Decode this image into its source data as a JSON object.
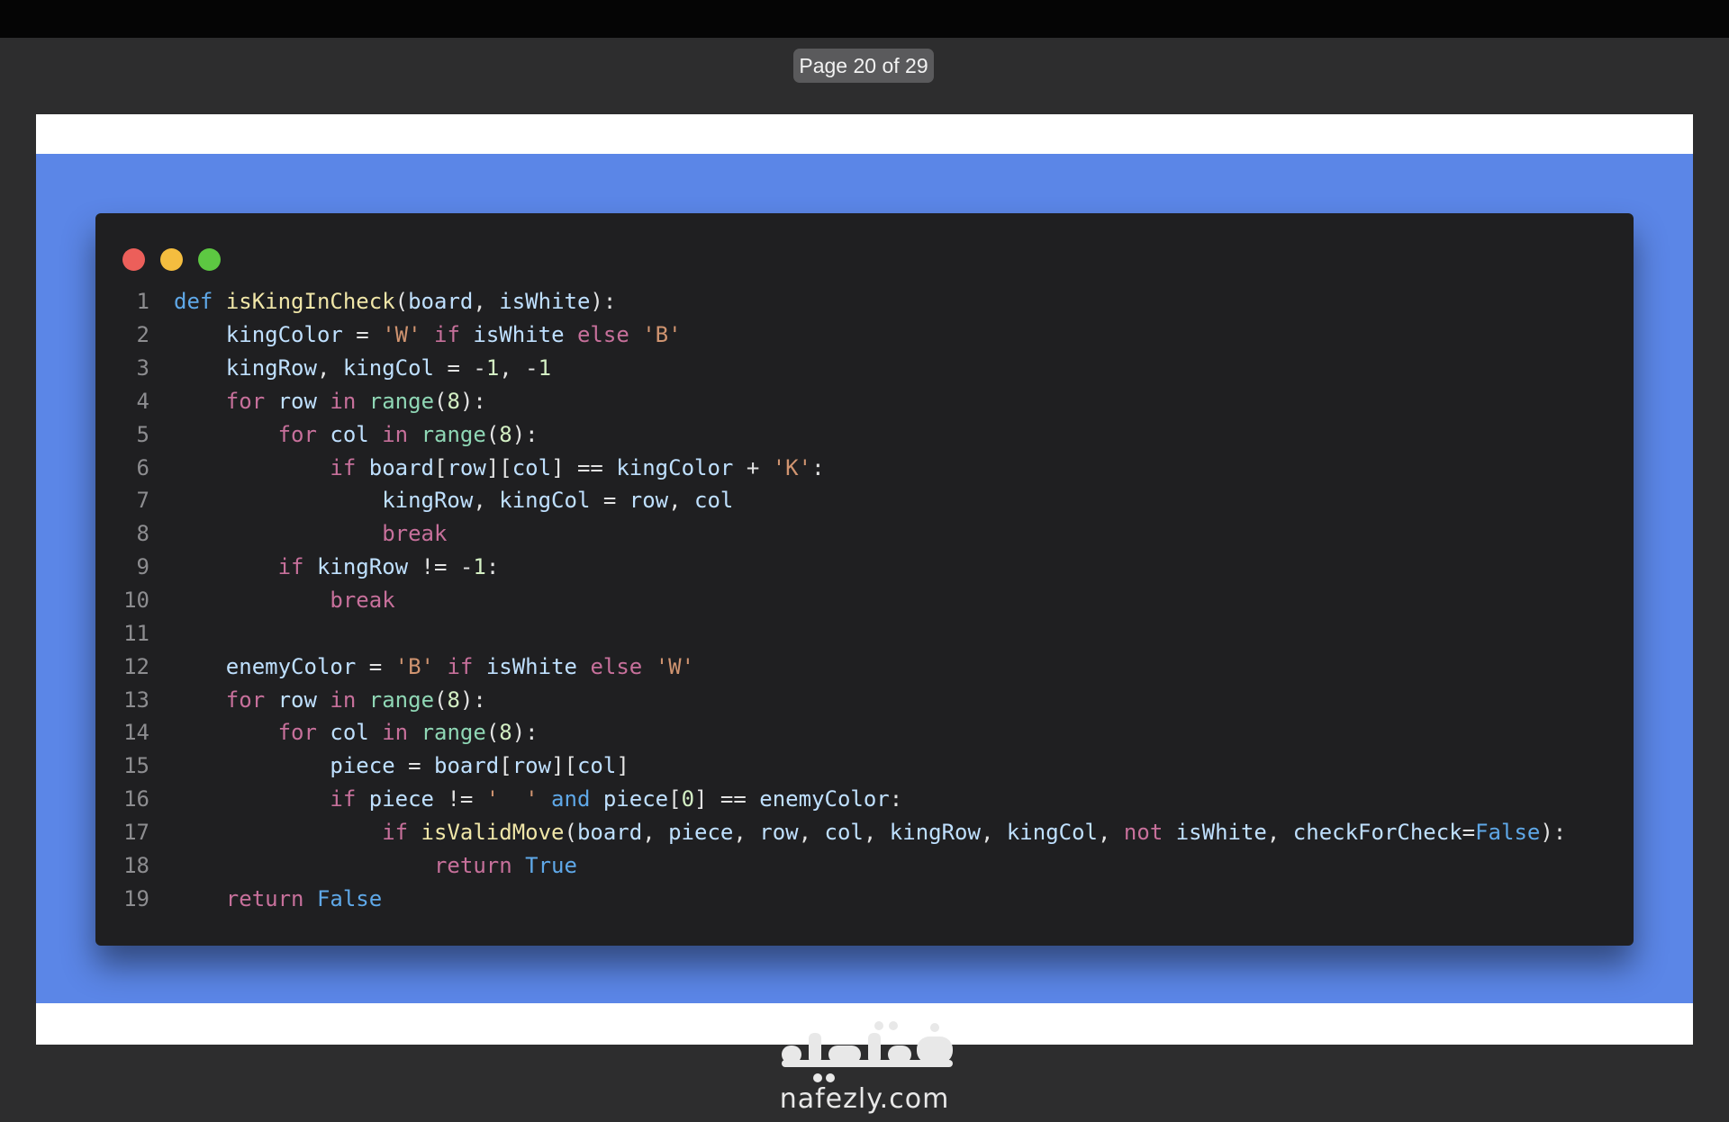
{
  "viewer": {
    "page_indicator": "Page 20 of 29"
  },
  "window_controls": {
    "close": "red",
    "minimize": "yellow",
    "maximize": "green"
  },
  "code": {
    "language": "python",
    "lines": [
      {
        "n": "1",
        "tokens": [
          [
            "kw-def",
            "def"
          ],
          [
            "op",
            " "
          ],
          [
            "fn",
            "isKingInCheck"
          ],
          [
            "op",
            "("
          ],
          [
            "id",
            "board"
          ],
          [
            "op",
            ", "
          ],
          [
            "id",
            "isWhite"
          ],
          [
            "op",
            "):"
          ]
        ]
      },
      {
        "n": "2",
        "tokens": [
          [
            "op",
            "    "
          ],
          [
            "id",
            "kingColor"
          ],
          [
            "op",
            " = "
          ],
          [
            "str",
            "'W'"
          ],
          [
            "op",
            " "
          ],
          [
            "kw",
            "if"
          ],
          [
            "op",
            " "
          ],
          [
            "id",
            "isWhite"
          ],
          [
            "op",
            " "
          ],
          [
            "kw",
            "else"
          ],
          [
            "op",
            " "
          ],
          [
            "str",
            "'B'"
          ]
        ]
      },
      {
        "n": "3",
        "tokens": [
          [
            "op",
            "    "
          ],
          [
            "id",
            "kingRow"
          ],
          [
            "op",
            ", "
          ],
          [
            "id",
            "kingCol"
          ],
          [
            "op",
            " = -"
          ],
          [
            "num",
            "1"
          ],
          [
            "op",
            ", -"
          ],
          [
            "num",
            "1"
          ]
        ]
      },
      {
        "n": "4",
        "tokens": [
          [
            "op",
            "    "
          ],
          [
            "kw",
            "for"
          ],
          [
            "op",
            " "
          ],
          [
            "id",
            "row"
          ],
          [
            "op",
            " "
          ],
          [
            "kw",
            "in"
          ],
          [
            "op",
            " "
          ],
          [
            "bi",
            "range"
          ],
          [
            "op",
            "("
          ],
          [
            "num",
            "8"
          ],
          [
            "op",
            "):"
          ]
        ]
      },
      {
        "n": "5",
        "tokens": [
          [
            "op",
            "        "
          ],
          [
            "kw",
            "for"
          ],
          [
            "op",
            " "
          ],
          [
            "id",
            "col"
          ],
          [
            "op",
            " "
          ],
          [
            "kw",
            "in"
          ],
          [
            "op",
            " "
          ],
          [
            "bi",
            "range"
          ],
          [
            "op",
            "("
          ],
          [
            "num",
            "8"
          ],
          [
            "op",
            "):"
          ]
        ]
      },
      {
        "n": "6",
        "tokens": [
          [
            "op",
            "            "
          ],
          [
            "kw",
            "if"
          ],
          [
            "op",
            " "
          ],
          [
            "id",
            "board"
          ],
          [
            "op",
            "["
          ],
          [
            "id",
            "row"
          ],
          [
            "op",
            "]["
          ],
          [
            "id",
            "col"
          ],
          [
            "op",
            "] == "
          ],
          [
            "id",
            "kingColor"
          ],
          [
            "op",
            " + "
          ],
          [
            "str",
            "'K'"
          ],
          [
            "op",
            ":"
          ]
        ]
      },
      {
        "n": "7",
        "tokens": [
          [
            "op",
            "                "
          ],
          [
            "id",
            "kingRow"
          ],
          [
            "op",
            ", "
          ],
          [
            "id",
            "kingCol"
          ],
          [
            "op",
            " = "
          ],
          [
            "id",
            "row"
          ],
          [
            "op",
            ", "
          ],
          [
            "id",
            "col"
          ]
        ]
      },
      {
        "n": "8",
        "tokens": [
          [
            "op",
            "                "
          ],
          [
            "kw",
            "break"
          ]
        ]
      },
      {
        "n": "9",
        "tokens": [
          [
            "op",
            "        "
          ],
          [
            "kw",
            "if"
          ],
          [
            "op",
            " "
          ],
          [
            "id",
            "kingRow"
          ],
          [
            "op",
            " != -"
          ],
          [
            "num",
            "1"
          ],
          [
            "op",
            ":"
          ]
        ]
      },
      {
        "n": "10",
        "tokens": [
          [
            "op",
            "            "
          ],
          [
            "kw",
            "break"
          ]
        ]
      },
      {
        "n": "11",
        "tokens": []
      },
      {
        "n": "12",
        "tokens": [
          [
            "op",
            "    "
          ],
          [
            "id",
            "enemyColor"
          ],
          [
            "op",
            " = "
          ],
          [
            "str",
            "'B'"
          ],
          [
            "op",
            " "
          ],
          [
            "kw",
            "if"
          ],
          [
            "op",
            " "
          ],
          [
            "id",
            "isWhite"
          ],
          [
            "op",
            " "
          ],
          [
            "kw",
            "else"
          ],
          [
            "op",
            " "
          ],
          [
            "str",
            "'W'"
          ]
        ]
      },
      {
        "n": "13",
        "tokens": [
          [
            "op",
            "    "
          ],
          [
            "kw",
            "for"
          ],
          [
            "op",
            " "
          ],
          [
            "id",
            "row"
          ],
          [
            "op",
            " "
          ],
          [
            "kw",
            "in"
          ],
          [
            "op",
            " "
          ],
          [
            "bi",
            "range"
          ],
          [
            "op",
            "("
          ],
          [
            "num",
            "8"
          ],
          [
            "op",
            "):"
          ]
        ]
      },
      {
        "n": "14",
        "tokens": [
          [
            "op",
            "        "
          ],
          [
            "kw",
            "for"
          ],
          [
            "op",
            " "
          ],
          [
            "id",
            "col"
          ],
          [
            "op",
            " "
          ],
          [
            "kw",
            "in"
          ],
          [
            "op",
            " "
          ],
          [
            "bi",
            "range"
          ],
          [
            "op",
            "("
          ],
          [
            "num",
            "8"
          ],
          [
            "op",
            "):"
          ]
        ]
      },
      {
        "n": "15",
        "tokens": [
          [
            "op",
            "            "
          ],
          [
            "id",
            "piece"
          ],
          [
            "op",
            " = "
          ],
          [
            "id",
            "board"
          ],
          [
            "op",
            "["
          ],
          [
            "id",
            "row"
          ],
          [
            "op",
            "]["
          ],
          [
            "id",
            "col"
          ],
          [
            "op",
            "]"
          ]
        ]
      },
      {
        "n": "16",
        "tokens": [
          [
            "op",
            "            "
          ],
          [
            "kw",
            "if"
          ],
          [
            "op",
            " "
          ],
          [
            "id",
            "piece"
          ],
          [
            "op",
            " != "
          ],
          [
            "str",
            "'  '"
          ],
          [
            "op",
            " "
          ],
          [
            "const",
            "and"
          ],
          [
            "op",
            " "
          ],
          [
            "id",
            "piece"
          ],
          [
            "op",
            "["
          ],
          [
            "num",
            "0"
          ],
          [
            "op",
            "] == "
          ],
          [
            "id",
            "enemyColor"
          ],
          [
            "op",
            ":"
          ]
        ]
      },
      {
        "n": "17",
        "tokens": [
          [
            "op",
            "                "
          ],
          [
            "kw",
            "if"
          ],
          [
            "op",
            " "
          ],
          [
            "fn",
            "isValidMove"
          ],
          [
            "op",
            "("
          ],
          [
            "id",
            "board"
          ],
          [
            "op",
            ", "
          ],
          [
            "id",
            "piece"
          ],
          [
            "op",
            ", "
          ],
          [
            "id",
            "row"
          ],
          [
            "op",
            ", "
          ],
          [
            "id",
            "col"
          ],
          [
            "op",
            ", "
          ],
          [
            "id",
            "kingRow"
          ],
          [
            "op",
            ", "
          ],
          [
            "id",
            "kingCol"
          ],
          [
            "op",
            ", "
          ],
          [
            "kw",
            "not"
          ],
          [
            "op",
            " "
          ],
          [
            "id",
            "isWhite"
          ],
          [
            "op",
            ", "
          ],
          [
            "id",
            "checkForCheck"
          ],
          [
            "op",
            "="
          ],
          [
            "const",
            "False"
          ],
          [
            "op",
            "):"
          ]
        ]
      },
      {
        "n": "18",
        "tokens": [
          [
            "op",
            "                    "
          ],
          [
            "kw",
            "return"
          ],
          [
            "op",
            " "
          ],
          [
            "const",
            "True"
          ]
        ]
      },
      {
        "n": "19",
        "tokens": [
          [
            "op",
            "    "
          ],
          [
            "kw",
            "return"
          ],
          [
            "op",
            " "
          ],
          [
            "const",
            "False"
          ]
        ]
      }
    ]
  },
  "watermark": {
    "arabic": "نفذلي",
    "latin": "nafezly.com"
  }
}
